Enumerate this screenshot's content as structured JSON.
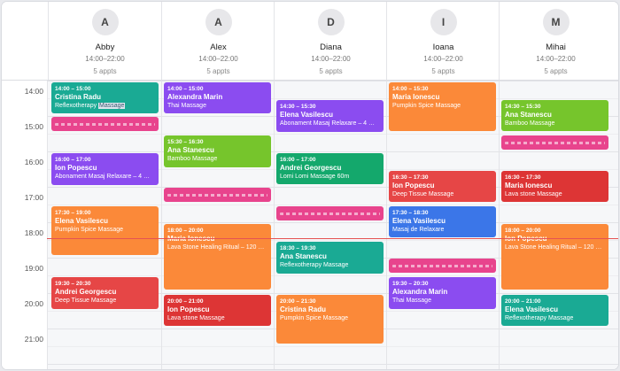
{
  "time_labels": [
    "14:00",
    "15:00",
    "16:00",
    "17:00",
    "18:00",
    "19:00",
    "20:00",
    "21:00"
  ],
  "staff": [
    {
      "initial": "A",
      "name": "Abby",
      "hours": "14:00–22:00",
      "appts": "5 appts"
    },
    {
      "initial": "A",
      "name": "Alex",
      "hours": "14:00–22:00",
      "appts": "5 appts"
    },
    {
      "initial": "D",
      "name": "Diana",
      "hours": "14:00–22:00",
      "appts": "5 appts"
    },
    {
      "initial": "I",
      "name": "Ioana",
      "hours": "14:00–22:00",
      "appts": "5 appts"
    },
    {
      "initial": "M",
      "name": "Mihai",
      "hours": "14:00–22:00",
      "appts": "5 appts"
    }
  ],
  "appointments": [
    {
      "time": "14:00 – 15:00",
      "client": "Cristina Radu",
      "service": "Reflexotherapy",
      "service_highlight": "Massage",
      "color": "#1aaa94"
    },
    {
      "time": "",
      "client": "",
      "service": "",
      "color": "#e8448d"
    },
    {
      "time": "16:00 – 17:00",
      "client": "Ion Popescu",
      "service": "Abonament Masaj Relaxare – 4 …",
      "color": "#8b4cf0"
    },
    {
      "time": "17:30 – 19:00",
      "client": "Elena Vasilescu",
      "service": "Pumpkin Spice Massage",
      "color": "#fb8939"
    },
    {
      "time": "19:30 – 20:30",
      "client": "Andrei Georgescu",
      "service": "Deep Tissue Massage",
      "color": "#e64646"
    },
    {
      "time": "14:00 – 15:00",
      "client": "Alexandra Marin",
      "service": "Thai Massage",
      "color": "#8b4cf0"
    },
    {
      "time": "15:30 – 16:30",
      "client": "Ana Stanescu",
      "service": "Bamboo Massage",
      "color": "#76c52c"
    },
    {
      "time": "",
      "client": "",
      "service": "",
      "color": "#e8448d"
    },
    {
      "time": "18:00 – 20:00",
      "client": "Maria Ionescu",
      "service": "Lava Stone Healing Ritual – 120 …",
      "color": "#fb8939"
    },
    {
      "time": "20:00 – 21:00",
      "client": "Ion Popescu",
      "service": "Lava stone Massage",
      "color": "#dd3535"
    },
    {
      "time": "14:30 – 15:30",
      "client": "Elena Vasilescu",
      "service": "Abonament Masaj Relaxare – 4 …",
      "color": "#8b4cf0"
    },
    {
      "time": "16:00 – 17:00",
      "client": "Andrei Georgescu",
      "service": "Lomi Lomi Massage 60m",
      "color": "#14a86c"
    },
    {
      "time": "",
      "client": "",
      "service": "",
      "color": "#e8448d"
    },
    {
      "time": "18:30 – 19:30",
      "client": "Ana Stanescu",
      "service": "Reflexotherapy Massage",
      "color": "#1aaa94"
    },
    {
      "time": "20:00 – 21:30",
      "client": "Cristina Radu",
      "service": "Pumpkin Spice Massage",
      "color": "#fb8939"
    },
    {
      "time": "14:00 – 15:30",
      "client": "Maria Ionescu",
      "service": "Pumpkin Spice Massage",
      "color": "#fb8939"
    },
    {
      "time": "16:30 – 17:30",
      "client": "Ion Popescu",
      "service": "Deep Tissue Massage",
      "color": "#e64646"
    },
    {
      "time": "17:30 – 18:30",
      "client": "Elena Vasilescu",
      "service": "Masaj de Relaxare",
      "color": "#3b76e8"
    },
    {
      "time": "",
      "client": "",
      "service": "",
      "color": "#e8448d"
    },
    {
      "time": "19:30 – 20:30",
      "client": "Alexandra Marin",
      "service": "Thai Massage",
      "color": "#8b4cf0"
    },
    {
      "time": "14:30 – 15:30",
      "client": "Ana Stanescu",
      "service": "Bamboo Massage",
      "color": "#76c52c"
    },
    {
      "time": "",
      "client": "",
      "service": "",
      "color": "#e8448d"
    },
    {
      "time": "16:30 – 17:30",
      "client": "Maria Ionescu",
      "service": "Lava stone Massage",
      "color": "#dd3535"
    },
    {
      "time": "18:00 – 20:00",
      "client": "Ion Popescu",
      "service": "Lava Stone Healing Ritual – 120 …",
      "color": "#fb8939"
    },
    {
      "time": "20:00 – 21:00",
      "client": "Elena Vasilescu",
      "service": "Reflexotherapy Massage",
      "color": "#1aaa94"
    }
  ]
}
